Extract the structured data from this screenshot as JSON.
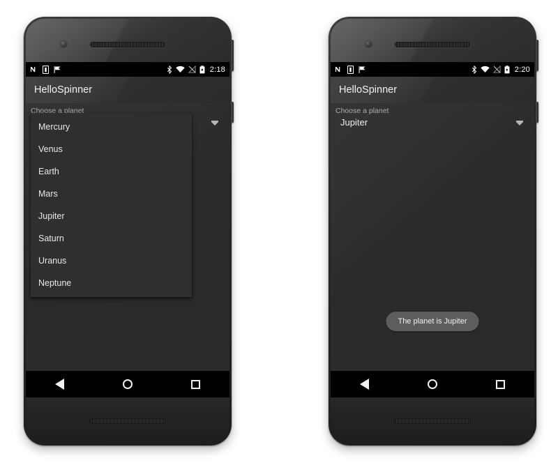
{
  "devices": [
    {
      "id": "left-phone",
      "status_bar": {
        "notification_icons": [
          "nfc-icon",
          "sim-card-icon",
          "flag-icon"
        ],
        "system_icons": [
          "bluetooth-icon",
          "wifi-icon",
          "cellular-off-icon",
          "battery-icon"
        ],
        "time": "2:18"
      },
      "app_bar": {
        "title": "HelloSpinner"
      },
      "content": {
        "spinner_label": "Choose a planet",
        "spinner_value": "Mercury",
        "dropdown_open": true,
        "dropdown_items": [
          "Mercury",
          "Venus",
          "Earth",
          "Mars",
          "Jupiter",
          "Saturn",
          "Uranus",
          "Neptune"
        ],
        "toast": null
      },
      "nav_bar": {
        "back": "back-icon",
        "home": "home-icon",
        "recents": "recents-icon"
      }
    },
    {
      "id": "right-phone",
      "status_bar": {
        "notification_icons": [
          "nfc-icon",
          "sim-card-icon",
          "flag-icon"
        ],
        "system_icons": [
          "bluetooth-icon",
          "wifi-icon",
          "cellular-off-icon",
          "battery-icon"
        ],
        "time": "2:20"
      },
      "app_bar": {
        "title": "HelloSpinner"
      },
      "content": {
        "spinner_label": "Choose a planet",
        "spinner_value": "Jupiter",
        "dropdown_open": false,
        "dropdown_items": [],
        "toast": "The planet is Jupiter"
      },
      "nav_bar": {
        "back": "back-icon",
        "home": "home-icon",
        "recents": "recents-icon"
      }
    }
  ],
  "colors": {
    "page_background": "#ffffff",
    "status_bar": "#000000",
    "app_bar": "#343434",
    "screen_background": "#2b2b2b",
    "dropdown_background": "#2f2f2f",
    "toast_background": "#5d5d5d",
    "primary_text": "#f0f0f0",
    "secondary_text": "#adadad"
  }
}
